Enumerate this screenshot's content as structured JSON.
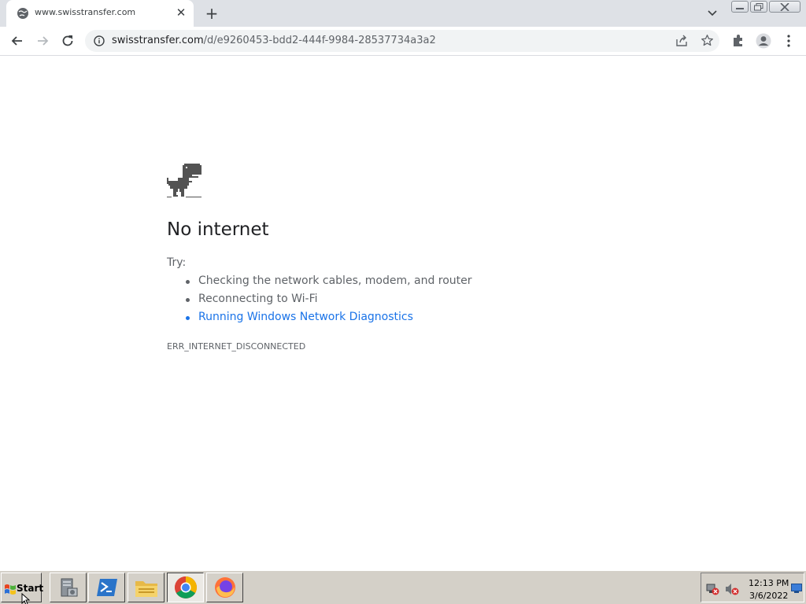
{
  "browser": {
    "tab_title": "www.swisstransfer.com",
    "url_host": "swisstransfer.com",
    "url_path": "/d/e9260453-bdd2-444f-9984-28537734a3a2"
  },
  "error_page": {
    "title": "No internet",
    "try_label": "Try:",
    "suggestions": [
      "Checking the network cables, modem, and router",
      "Reconnecting to Wi-Fi",
      "Running Windows Network Diagnostics"
    ],
    "error_code": "ERR_INTERNET_DISCONNECTED"
  },
  "taskbar": {
    "start_label": "Start",
    "clock_time": "12:13 PM",
    "clock_date": "3/6/2022"
  },
  "colors": {
    "link": "#1a73e8",
    "text_secondary": "#5f6368",
    "tabstrip": "#dee1e6",
    "taskbar": "#d4d0c8"
  },
  "icons": {
    "tab_favicon": "globe-icon",
    "error_art": "dinosaur-icon",
    "browser_apps": [
      "server-manager-icon",
      "powershell-icon",
      "file-explorer-icon",
      "chrome-icon",
      "firefox-icon"
    ]
  }
}
